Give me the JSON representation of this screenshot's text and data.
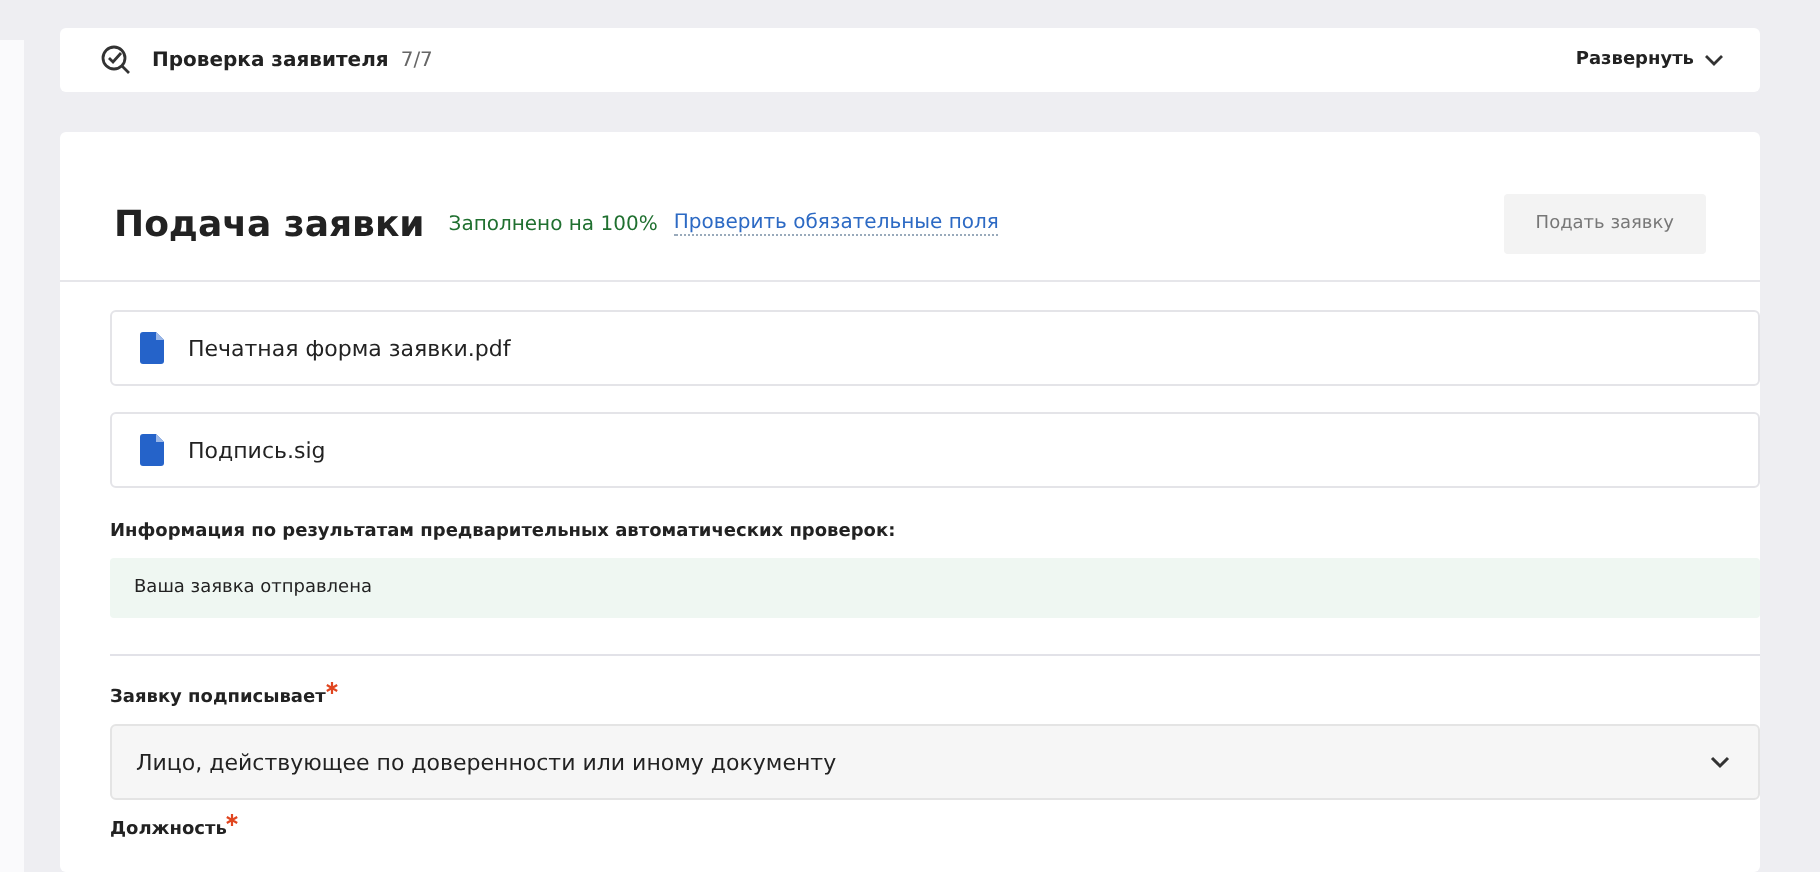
{
  "check_panel": {
    "title": "Проверка заявителя",
    "count": "7/7",
    "expand_label": "Развернуть"
  },
  "submission": {
    "title": "Подача заявки",
    "fill_status": "Заполнено на 100%",
    "check_link": "Проверить обязательные поля",
    "submit_button": {
      "label": "Подать заявку",
      "disabled": true
    },
    "files": [
      {
        "name": "Печатная форма заявки.pdf"
      },
      {
        "name": "Подпись.sig"
      }
    ],
    "check_info": {
      "label": "Информация по результатам предварительных автоматических проверок:",
      "message": "Ваша заявка отправлена"
    },
    "fields": [
      {
        "kind": "select",
        "label": "Заявку подписывает",
        "required": true,
        "value": "Лицо, действующее по доверенности или иному документу"
      },
      {
        "kind": "label",
        "label": "Должность",
        "required": true
      }
    ]
  }
}
